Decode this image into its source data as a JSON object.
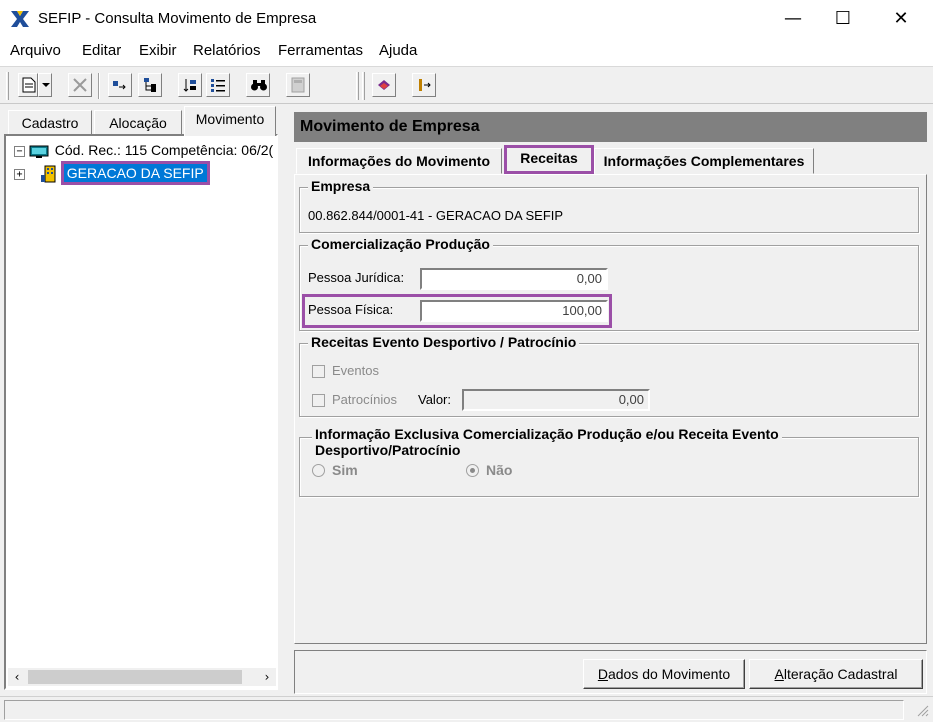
{
  "window": {
    "title": "SEFIP - Consulta Movimento de Empresa",
    "minimize": "—",
    "maximize": "☐",
    "close": "✕"
  },
  "menu": [
    "Arquivo",
    "Editar",
    "Exibir",
    "Relatórios",
    "Ferramentas",
    "Ajuda"
  ],
  "left": {
    "tabs": [
      "Cadastro",
      "Alocação",
      "Movimento"
    ],
    "active_tab": "Movimento",
    "tree": {
      "root_label": "Cód. Rec.: 115 Competência: 06/2(",
      "child_label": "GERACAO DA SEFIP"
    },
    "scroll_left": "‹",
    "scroll_right": "›"
  },
  "right": {
    "header": "Movimento de Empresa",
    "tabs": [
      "Informações do Movimento",
      "Receitas",
      "Informações Complementares"
    ],
    "active_tab": "Receitas",
    "empresa": {
      "title": "Empresa",
      "value": "00.862.844/0001-41 -  GERACAO DA SEFIP"
    },
    "comercializacao": {
      "title": "Comercialização Produção",
      "pj_label": "Pessoa Jurídica:",
      "pj_value": "0,00",
      "pf_label": "Pessoa Física:",
      "pf_value": "100,00"
    },
    "receitas_evento": {
      "title": "Receitas Evento Desportivo / Patrocínio",
      "eventos_label": "Eventos",
      "patrocinios_label": "Patrocínios",
      "valor_label": "Valor:",
      "valor_value": "0,00"
    },
    "info_exclusiva": {
      "title_line1": "Informação Exclusiva Comercialização Produção e/ou Receita Evento",
      "title_line2": "Desportivo/Patrocínio",
      "sim_label": "Sim",
      "nao_label": "Não",
      "selected": "Não"
    },
    "buttons": {
      "dados_first": "D",
      "dados_rest": "ados do Movimento",
      "alteracao_first": "A",
      "alteracao_rest": "lteração Cadastral"
    }
  },
  "colors": {
    "highlight": "#9b4fa7",
    "selection": "#0078d7",
    "header_bar": "#808080"
  }
}
